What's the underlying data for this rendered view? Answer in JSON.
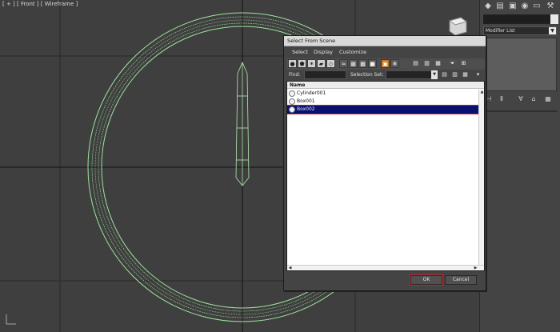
{
  "viewport": {
    "label": "[ + ] [ Front ] [ Wireframe ]"
  },
  "command_panel": {
    "modifier_list": "Modifier List",
    "icons": [
      "create-icon",
      "modify-icon",
      "hierarchy-icon",
      "motion-icon",
      "display-icon",
      "utilities-icon"
    ]
  },
  "dialog": {
    "title": "Select From Scene",
    "menu": [
      "Select",
      "Display",
      "Customize"
    ],
    "find_label": "Find:",
    "selection_set_label": "Selection Set:",
    "list_header": "Name",
    "objects": [
      {
        "name": "Cylinder001",
        "selected": false
      },
      {
        "name": "Box001",
        "selected": false
      },
      {
        "name": "Box002",
        "selected": true
      }
    ],
    "ok_label": "OK",
    "cancel_label": "Cancel"
  },
  "colors": {
    "wireframe": "#9fe39f",
    "selection": "#0a1070",
    "highlight": "#c1272d"
  }
}
